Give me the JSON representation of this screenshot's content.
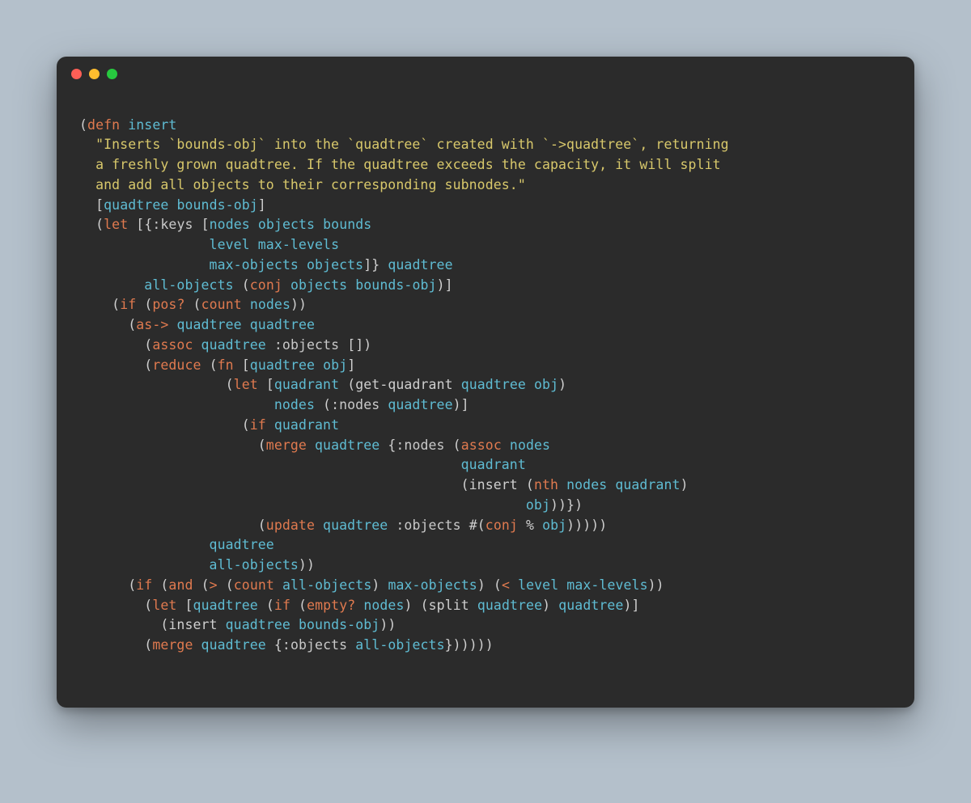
{
  "window": {
    "traffic_lights": [
      "close",
      "minimize",
      "zoom"
    ]
  },
  "code": {
    "tokens": [
      {
        "t": "(",
        "c": "p"
      },
      {
        "t": "defn",
        "c": "kw"
      },
      {
        "t": " "
      },
      {
        "t": "insert",
        "c": "nm"
      },
      {
        "t": "\n"
      },
      {
        "t": "  "
      },
      {
        "t": "\"Inserts `bounds-obj` into the `quadtree` created with `->quadtree`, returning",
        "c": "st"
      },
      {
        "t": "\n"
      },
      {
        "t": "  "
      },
      {
        "t": "a freshly grown quadtree. If the quadtree exceeds the capacity, it will split",
        "c": "st"
      },
      {
        "t": "\n"
      },
      {
        "t": "  "
      },
      {
        "t": "and add all objects to their corresponding subnodes.\"",
        "c": "st"
      },
      {
        "t": "\n"
      },
      {
        "t": "  "
      },
      {
        "t": "[",
        "c": "p"
      },
      {
        "t": "quadtree",
        "c": "nm"
      },
      {
        "t": " "
      },
      {
        "t": "bounds-obj",
        "c": "nm"
      },
      {
        "t": "]",
        "c": "p"
      },
      {
        "t": "\n"
      },
      {
        "t": "  "
      },
      {
        "t": "(",
        "c": "p"
      },
      {
        "t": "let",
        "c": "kw"
      },
      {
        "t": " "
      },
      {
        "t": "[{",
        "c": "p"
      },
      {
        "t": ":keys",
        "c": "ky"
      },
      {
        "t": " ",
        "c": "p"
      },
      {
        "t": "[",
        "c": "p"
      },
      {
        "t": "nodes",
        "c": "nm"
      },
      {
        "t": " "
      },
      {
        "t": "objects",
        "c": "nm"
      },
      {
        "t": " "
      },
      {
        "t": "bounds",
        "c": "nm"
      },
      {
        "t": "\n"
      },
      {
        "t": "                "
      },
      {
        "t": "level",
        "c": "nm"
      },
      {
        "t": " "
      },
      {
        "t": "max-levels",
        "c": "nm"
      },
      {
        "t": "\n"
      },
      {
        "t": "                "
      },
      {
        "t": "max-objects",
        "c": "nm"
      },
      {
        "t": " "
      },
      {
        "t": "objects",
        "c": "nm"
      },
      {
        "t": "]}",
        "c": "p"
      },
      {
        "t": " "
      },
      {
        "t": "quadtree",
        "c": "nm"
      },
      {
        "t": "\n"
      },
      {
        "t": "        "
      },
      {
        "t": "all-objects",
        "c": "nm"
      },
      {
        "t": " "
      },
      {
        "t": "(",
        "c": "p"
      },
      {
        "t": "conj",
        "c": "kw"
      },
      {
        "t": " "
      },
      {
        "t": "objects",
        "c": "nm"
      },
      {
        "t": " "
      },
      {
        "t": "bounds-obj",
        "c": "nm"
      },
      {
        "t": ")]",
        "c": "p"
      },
      {
        "t": "\n"
      },
      {
        "t": "    "
      },
      {
        "t": "(",
        "c": "p"
      },
      {
        "t": "if",
        "c": "kw"
      },
      {
        "t": " "
      },
      {
        "t": "(",
        "c": "p"
      },
      {
        "t": "pos?",
        "c": "kw"
      },
      {
        "t": " "
      },
      {
        "t": "(",
        "c": "p"
      },
      {
        "t": "count",
        "c": "kw"
      },
      {
        "t": " "
      },
      {
        "t": "nodes",
        "c": "nm"
      },
      {
        "t": "))",
        "c": "p"
      },
      {
        "t": "\n"
      },
      {
        "t": "      "
      },
      {
        "t": "(",
        "c": "p"
      },
      {
        "t": "as->",
        "c": "kw"
      },
      {
        "t": " "
      },
      {
        "t": "quadtree",
        "c": "nm"
      },
      {
        "t": " "
      },
      {
        "t": "quadtree",
        "c": "nm"
      },
      {
        "t": "\n"
      },
      {
        "t": "        "
      },
      {
        "t": "(",
        "c": "p"
      },
      {
        "t": "assoc",
        "c": "kw"
      },
      {
        "t": " "
      },
      {
        "t": "quadtree",
        "c": "nm"
      },
      {
        "t": " "
      },
      {
        "t": ":objects",
        "c": "ky"
      },
      {
        "t": " "
      },
      {
        "t": "[])",
        "c": "p"
      },
      {
        "t": "\n"
      },
      {
        "t": "        "
      },
      {
        "t": "(",
        "c": "p"
      },
      {
        "t": "reduce",
        "c": "kw"
      },
      {
        "t": " "
      },
      {
        "t": "(",
        "c": "p"
      },
      {
        "t": "fn",
        "c": "kw"
      },
      {
        "t": " "
      },
      {
        "t": "[",
        "c": "p"
      },
      {
        "t": "quadtree",
        "c": "nm"
      },
      {
        "t": " "
      },
      {
        "t": "obj",
        "c": "nm"
      },
      {
        "t": "]",
        "c": "p"
      },
      {
        "t": "\n"
      },
      {
        "t": "                  "
      },
      {
        "t": "(",
        "c": "p"
      },
      {
        "t": "let",
        "c": "kw"
      },
      {
        "t": " "
      },
      {
        "t": "[",
        "c": "p"
      },
      {
        "t": "quadrant",
        "c": "nm"
      },
      {
        "t": " "
      },
      {
        "t": "(",
        "c": "p"
      },
      {
        "t": "get-quadrant",
        "c": "p"
      },
      {
        "t": " "
      },
      {
        "t": "quadtree",
        "c": "nm"
      },
      {
        "t": " "
      },
      {
        "t": "obj",
        "c": "nm"
      },
      {
        "t": ")",
        "c": "p"
      },
      {
        "t": "\n"
      },
      {
        "t": "                        "
      },
      {
        "t": "nodes",
        "c": "nm"
      },
      {
        "t": " "
      },
      {
        "t": "(",
        "c": "p"
      },
      {
        "t": ":nodes",
        "c": "ky"
      },
      {
        "t": " "
      },
      {
        "t": "quadtree",
        "c": "nm"
      },
      {
        "t": ")]",
        "c": "p"
      },
      {
        "t": "\n"
      },
      {
        "t": "                    "
      },
      {
        "t": "(",
        "c": "p"
      },
      {
        "t": "if",
        "c": "kw"
      },
      {
        "t": " "
      },
      {
        "t": "quadrant",
        "c": "nm"
      },
      {
        "t": "\n"
      },
      {
        "t": "                      "
      },
      {
        "t": "(",
        "c": "p"
      },
      {
        "t": "merge",
        "c": "kw"
      },
      {
        "t": " "
      },
      {
        "t": "quadtree",
        "c": "nm"
      },
      {
        "t": " "
      },
      {
        "t": "{",
        "c": "p"
      },
      {
        "t": ":nodes",
        "c": "ky"
      },
      {
        "t": " "
      },
      {
        "t": "(",
        "c": "p"
      },
      {
        "t": "assoc",
        "c": "kw"
      },
      {
        "t": " "
      },
      {
        "t": "nodes",
        "c": "nm"
      },
      {
        "t": "\n"
      },
      {
        "t": "                                               "
      },
      {
        "t": "quadrant",
        "c": "nm"
      },
      {
        "t": "\n"
      },
      {
        "t": "                                               "
      },
      {
        "t": "(",
        "c": "p"
      },
      {
        "t": "insert",
        "c": "p"
      },
      {
        "t": " "
      },
      {
        "t": "(",
        "c": "p"
      },
      {
        "t": "nth",
        "c": "kw"
      },
      {
        "t": " "
      },
      {
        "t": "nodes",
        "c": "nm"
      },
      {
        "t": " "
      },
      {
        "t": "quadrant",
        "c": "nm"
      },
      {
        "t": ")",
        "c": "p"
      },
      {
        "t": "\n"
      },
      {
        "t": "                                                       "
      },
      {
        "t": "obj",
        "c": "nm"
      },
      {
        "t": "))})",
        "c": "p"
      },
      {
        "t": "\n"
      },
      {
        "t": "                      "
      },
      {
        "t": "(",
        "c": "p"
      },
      {
        "t": "update",
        "c": "kw"
      },
      {
        "t": " "
      },
      {
        "t": "quadtree",
        "c": "nm"
      },
      {
        "t": " "
      },
      {
        "t": ":objects",
        "c": "ky"
      },
      {
        "t": " "
      },
      {
        "t": "#(",
        "c": "p"
      },
      {
        "t": "conj",
        "c": "kw"
      },
      {
        "t": " "
      },
      {
        "t": "%",
        "c": "p"
      },
      {
        "t": " "
      },
      {
        "t": "obj",
        "c": "nm"
      },
      {
        "t": ")))))",
        "c": "p"
      },
      {
        "t": "\n"
      },
      {
        "t": "                "
      },
      {
        "t": "quadtree",
        "c": "nm"
      },
      {
        "t": "\n"
      },
      {
        "t": "                "
      },
      {
        "t": "all-objects",
        "c": "nm"
      },
      {
        "t": "))",
        "c": "p"
      },
      {
        "t": "\n"
      },
      {
        "t": "      "
      },
      {
        "t": "(",
        "c": "p"
      },
      {
        "t": "if",
        "c": "kw"
      },
      {
        "t": " "
      },
      {
        "t": "(",
        "c": "p"
      },
      {
        "t": "and",
        "c": "kw"
      },
      {
        "t": " "
      },
      {
        "t": "(",
        "c": "p"
      },
      {
        "t": ">",
        "c": "kw"
      },
      {
        "t": " "
      },
      {
        "t": "(",
        "c": "p"
      },
      {
        "t": "count",
        "c": "kw"
      },
      {
        "t": " "
      },
      {
        "t": "all-objects",
        "c": "nm"
      },
      {
        "t": ")",
        "c": "p"
      },
      {
        "t": " "
      },
      {
        "t": "max-objects",
        "c": "nm"
      },
      {
        "t": ")",
        "c": "p"
      },
      {
        "t": " "
      },
      {
        "t": "(",
        "c": "p"
      },
      {
        "t": "<",
        "c": "kw"
      },
      {
        "t": " "
      },
      {
        "t": "level",
        "c": "nm"
      },
      {
        "t": " "
      },
      {
        "t": "max-levels",
        "c": "nm"
      },
      {
        "t": "))",
        "c": "p"
      },
      {
        "t": "\n"
      },
      {
        "t": "        "
      },
      {
        "t": "(",
        "c": "p"
      },
      {
        "t": "let",
        "c": "kw"
      },
      {
        "t": " "
      },
      {
        "t": "[",
        "c": "p"
      },
      {
        "t": "quadtree",
        "c": "nm"
      },
      {
        "t": " "
      },
      {
        "t": "(",
        "c": "p"
      },
      {
        "t": "if",
        "c": "kw"
      },
      {
        "t": " "
      },
      {
        "t": "(",
        "c": "p"
      },
      {
        "t": "empty?",
        "c": "kw"
      },
      {
        "t": " "
      },
      {
        "t": "nodes",
        "c": "nm"
      },
      {
        "t": ")",
        "c": "p"
      },
      {
        "t": " "
      },
      {
        "t": "(",
        "c": "p"
      },
      {
        "t": "split",
        "c": "p"
      },
      {
        "t": " "
      },
      {
        "t": "quadtree",
        "c": "nm"
      },
      {
        "t": ")",
        "c": "p"
      },
      {
        "t": " "
      },
      {
        "t": "quadtree",
        "c": "nm"
      },
      {
        "t": ")]",
        "c": "p"
      },
      {
        "t": "\n"
      },
      {
        "t": "          "
      },
      {
        "t": "(",
        "c": "p"
      },
      {
        "t": "insert",
        "c": "p"
      },
      {
        "t": " "
      },
      {
        "t": "quadtree",
        "c": "nm"
      },
      {
        "t": " "
      },
      {
        "t": "bounds-obj",
        "c": "nm"
      },
      {
        "t": "))",
        "c": "p"
      },
      {
        "t": "\n"
      },
      {
        "t": "        "
      },
      {
        "t": "(",
        "c": "p"
      },
      {
        "t": "merge",
        "c": "kw"
      },
      {
        "t": " "
      },
      {
        "t": "quadtree",
        "c": "nm"
      },
      {
        "t": " "
      },
      {
        "t": "{",
        "c": "p"
      },
      {
        "t": ":objects",
        "c": "ky"
      },
      {
        "t": " "
      },
      {
        "t": "all-objects",
        "c": "nm"
      },
      {
        "t": "})))))",
        "c": "p"
      }
    ]
  }
}
